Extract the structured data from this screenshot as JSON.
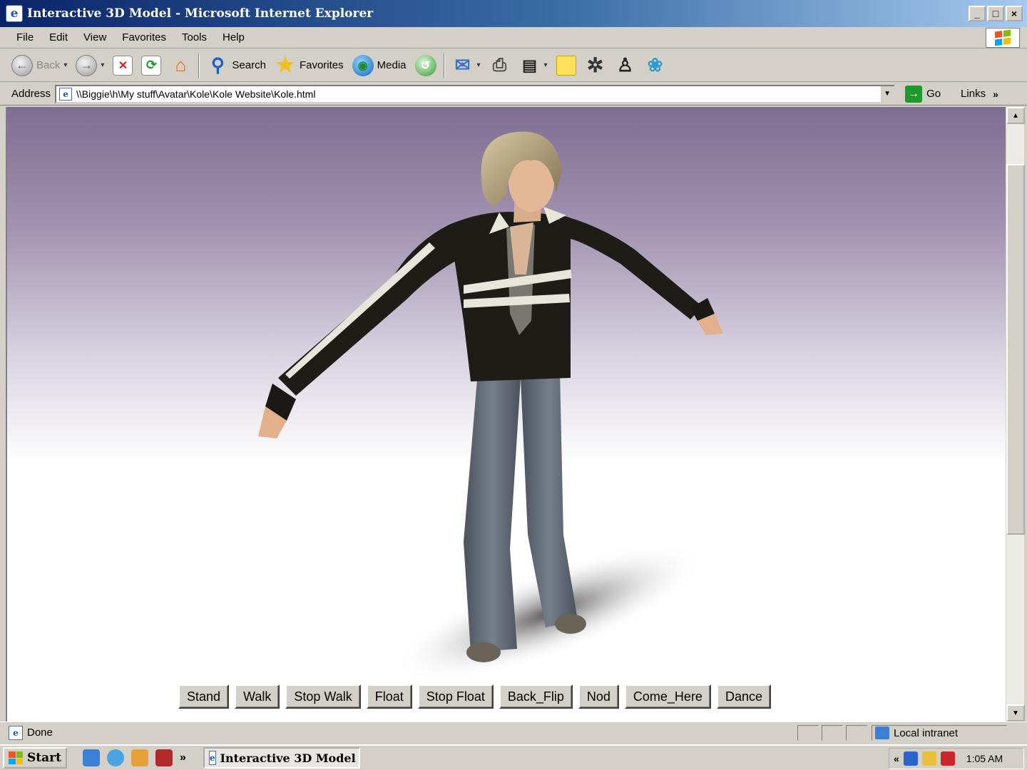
{
  "window": {
    "title": "Interactive 3D Model - Microsoft Internet Explorer",
    "minimize": "_",
    "maximize": "□",
    "close": "×"
  },
  "menu": [
    "File",
    "Edit",
    "View",
    "Favorites",
    "Tools",
    "Help"
  ],
  "toolbar": {
    "back_label": "Back",
    "search_label": "Search",
    "favorites_label": "Favorites",
    "media_label": "Media"
  },
  "address": {
    "label": "Address",
    "url": "\\\\Biggie\\h\\My stuff\\Avatar\\Kole\\Kole Website\\Kole.html",
    "go_label": "Go",
    "links_label": "Links"
  },
  "controls": {
    "stand": "Stand",
    "walk": "Walk",
    "stop_walk": "Stop Walk",
    "float": "Float",
    "stop_float": "Stop Float",
    "back_flip": "Back_Flip",
    "nod": "Nod",
    "come_here": "Come_Here",
    "dance": "Dance"
  },
  "status": {
    "text": "Done",
    "zone": "Local intranet"
  },
  "taskbar": {
    "start": "Start",
    "task": "Interactive 3D Model ...",
    "chevron": "»",
    "tray_chevron": "«",
    "clock": "1:05 AM"
  },
  "colors": {
    "bg_top": "#7e6e92",
    "jacket": "#1e1c16",
    "jeans": "#5d6670",
    "hair": "#b8a684"
  }
}
